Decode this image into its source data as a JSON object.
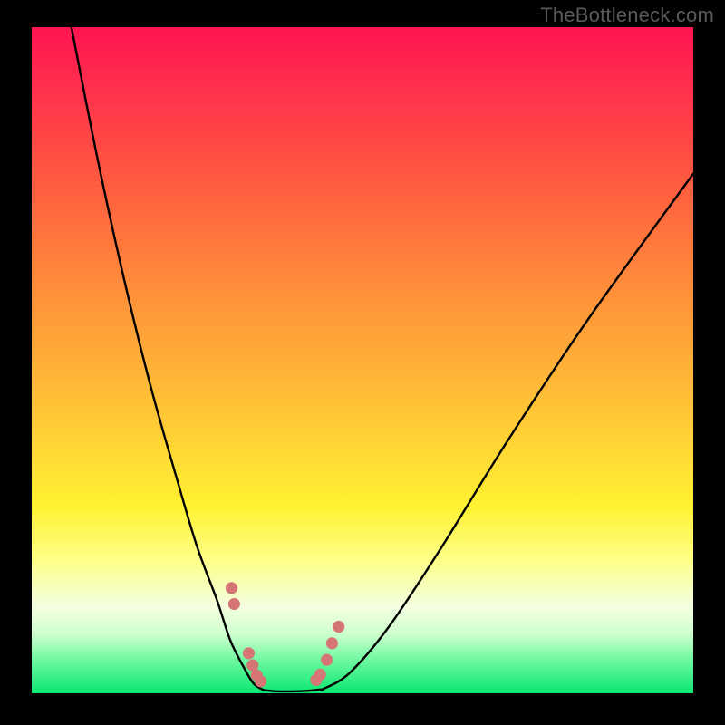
{
  "watermark": "TheBottleneck.com",
  "chart_data": {
    "type": "line",
    "title": "",
    "xlabel": "",
    "ylabel": "",
    "xlim": [
      0,
      100
    ],
    "ylim": [
      0,
      100
    ],
    "series": [
      {
        "name": "left-curve",
        "x": [
          6,
          10,
          14,
          18,
          22,
          25,
          28,
          30,
          32,
          33.5,
          35
        ],
        "values": [
          100,
          80,
          62,
          46,
          32,
          22,
          14,
          8,
          4,
          1.5,
          0.5
        ]
      },
      {
        "name": "valley-floor",
        "x": [
          35,
          37,
          40,
          42,
          44
        ],
        "values": [
          0.5,
          0.3,
          0.3,
          0.4,
          0.6
        ]
      },
      {
        "name": "right-curve",
        "x": [
          44,
          48,
          54,
          62,
          72,
          84,
          100
        ],
        "values": [
          0.6,
          3,
          10,
          22,
          38,
          56,
          78
        ]
      }
    ],
    "annotations": [
      {
        "name": "marker-left-1",
        "x": 30.2,
        "y": 15.8
      },
      {
        "name": "marker-left-2",
        "x": 30.6,
        "y": 13.4
      },
      {
        "name": "marker-left-3",
        "x": 32.8,
        "y": 6.0
      },
      {
        "name": "marker-left-4",
        "x": 33.4,
        "y": 4.2
      },
      {
        "name": "marker-left-5",
        "x": 34.0,
        "y": 2.7
      },
      {
        "name": "marker-left-6",
        "x": 34.6,
        "y": 1.8
      },
      {
        "name": "marker-right-7",
        "x": 43.0,
        "y": 2.0
      },
      {
        "name": "marker-right-8",
        "x": 43.6,
        "y": 2.8
      },
      {
        "name": "marker-right-9",
        "x": 44.6,
        "y": 5.0
      },
      {
        "name": "marker-right-10",
        "x": 45.4,
        "y": 7.5
      },
      {
        "name": "marker-right-11",
        "x": 46.4,
        "y": 10.0
      }
    ],
    "marker_color": "#d57575",
    "marker_radius_pct": 0.9,
    "curve_color": "#000000"
  }
}
